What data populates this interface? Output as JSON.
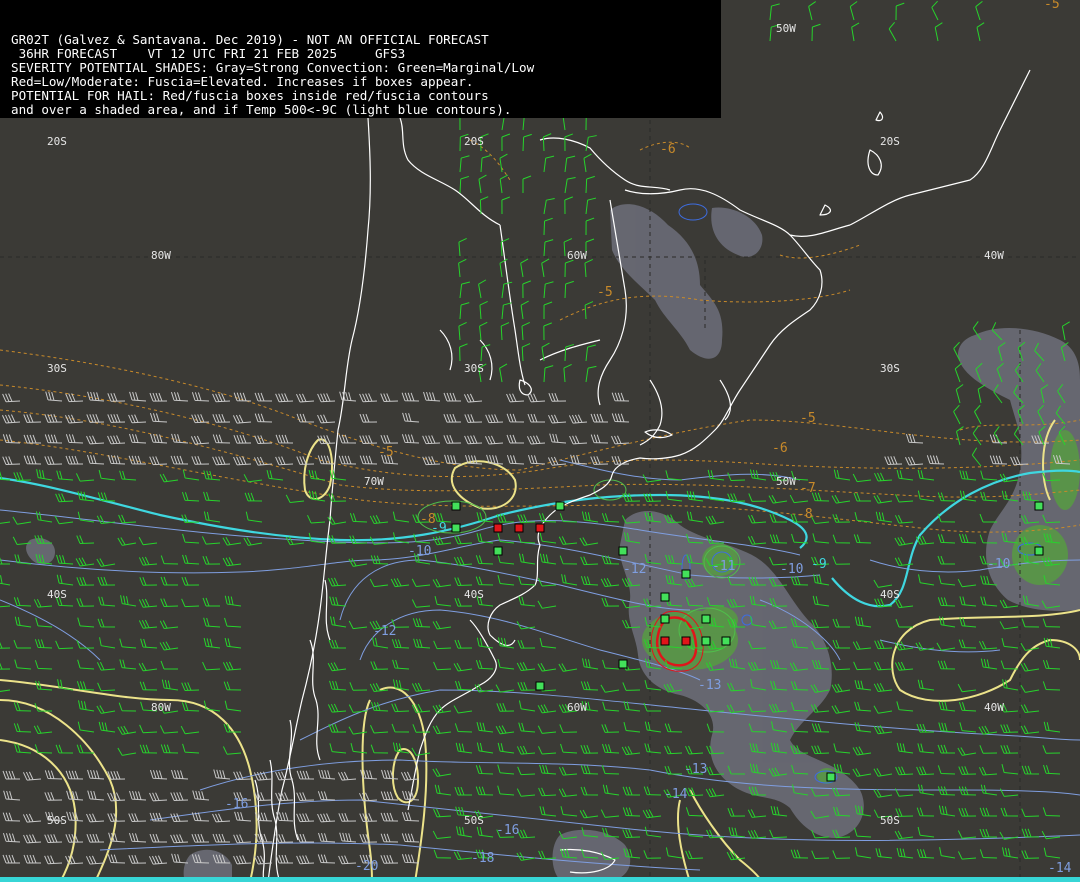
{
  "header": {
    "lines": [
      "GR02T (Galvez & Santavana. Dec 2019) - NOT AN OFFICIAL FORECAST",
      " 36HR FORECAST    VT 12 UTC FRI 21 FEB 2025     GFS3",
      "SEVERITY POTENTIAL SHADES: Gray=Strong Convection: Green=Marginal/Low",
      "Red=Low/Moderate: Fuscia=Elevated. Increases if boxes appear.",
      "POTENTIAL FOR HAIL: Red/fuscia boxes inside red/fuscia contours",
      "and over a shaded area, and if Temp 500<-9C (light blue contours)."
    ]
  },
  "grid_labels": {
    "lon_50w_top": "50W",
    "lat_20s_a": "20S",
    "lat_20s_b": "20S",
    "lat_20s_c": "20S",
    "lon_80w_a": "80W",
    "lon_60w_a": "60W",
    "lon_40w_a": "40W",
    "lat_30s_a": "30S",
    "lat_30s_b": "30S",
    "lat_30s_c": "30S",
    "lon_70w": "70W",
    "lon_50w_mid": "50W",
    "lat_40s_a": "40S",
    "lat_40s_b": "40S",
    "lat_40s_c": "40S",
    "lon_80w_b": "80W",
    "lon_60w_b": "60W",
    "lon_40w_b": "40W",
    "lat_50s_a": "50S",
    "lat_50s_b": "50S",
    "lat_50s_c": "50S"
  },
  "contour_labels": {
    "orange_neg6_top": "-6",
    "orange_neg5_a": "-5",
    "orange_neg5_b": "-5",
    "orange_neg5_c": "-5",
    "orange_neg6_b": "-6",
    "orange_neg7": "-7",
    "orange_neg8_a": "-8",
    "orange_neg8_b": "-8",
    "orange_neg5_d": "-5",
    "cyan_neg9_a": "-9",
    "cyan_neg9_b": "-9",
    "blue_neg10_a": "-10",
    "blue_neg10_b": "-10",
    "blue_neg10_c": "-10",
    "blue_neg11": "-11",
    "blue_neg12_a": "-12",
    "blue_neg12_b": "-12",
    "blue_neg13_a": "-13",
    "blue_neg13_b": "-13",
    "blue_neg14": "-14",
    "blue_neg16_a": "-16",
    "blue_neg16_b": "-16",
    "blue_neg18": "-18",
    "blue_neg20": "-20",
    "blue_neg14_br": "-14"
  },
  "colors": {
    "background": "#3b3a36",
    "coast": "#ffffff",
    "temp_minus9": "#3fd7e0",
    "temp_cold": "#7f9ee0",
    "temp_warm": "#c88a2a",
    "jet": "#ece38a",
    "barb_green": "#27d32c",
    "barb_white": "#c8c8c8",
    "shade_gray": "#6a6b75",
    "shade_green": "#52a33a",
    "box_green": "#43e05a",
    "box_red": "#e0151a",
    "contour_red": "#e0151a"
  }
}
